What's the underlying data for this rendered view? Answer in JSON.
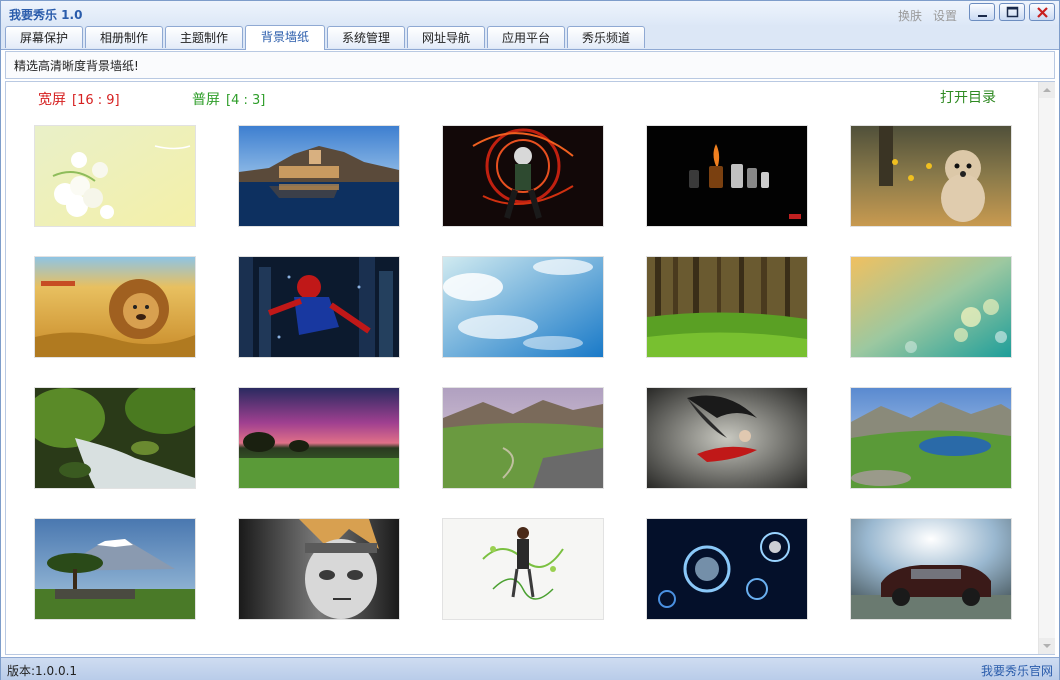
{
  "app": {
    "title": "我要秀乐 1.0",
    "skin_label": "换肤",
    "settings_label": "设置"
  },
  "tabs": [
    {
      "label": "屏幕保护",
      "active": false
    },
    {
      "label": "相册制作",
      "active": false
    },
    {
      "label": "主题制作",
      "active": false
    },
    {
      "label": "背景墙纸",
      "active": true
    },
    {
      "label": "系统管理",
      "active": false
    },
    {
      "label": "网址导航",
      "active": false
    },
    {
      "label": "应用平台",
      "active": false
    },
    {
      "label": "秀乐频道",
      "active": false
    }
  ],
  "info": {
    "text": "精选高清晰度背景墙纸!"
  },
  "filters": {
    "wide_label": "宽屏",
    "wide_ratio": "[16 : 9]",
    "normal_label": "普屏",
    "normal_ratio": "[4 : 3]",
    "open_dir_label": "打开目录"
  },
  "colors": {
    "accent": "#2a5cab",
    "wide_filter": "#d62020",
    "normal_filter": "#2f9e2a"
  },
  "wallpapers": [
    {
      "subject": "white roses on pale green",
      "icon": "roses-thumbnail"
    },
    {
      "subject": "coastal town at dusk reflected in water",
      "icon": "coastal-town-thumbnail"
    },
    {
      "subject": "anime ninja with red energy swirls",
      "icon": "ninja-thumbnail"
    },
    {
      "subject": "perfume bottles with flame on black",
      "icon": "perfume-thumbnail"
    },
    {
      "subject": "fluffy puppy among flowers",
      "icon": "puppy-thumbnail"
    },
    {
      "subject": "lion in golden grass",
      "icon": "lion-thumbnail"
    },
    {
      "subject": "spider hero over city lights",
      "icon": "spider-hero-thumbnail"
    },
    {
      "subject": "blue sky with scattered clouds",
      "icon": "sky-clouds-thumbnail"
    },
    {
      "subject": "sunlit forest with green grass",
      "icon": "forest-thumbnail"
    },
    {
      "subject": "teal bokeh lights",
      "icon": "bokeh-thumbnail"
    },
    {
      "subject": "mossy stream in forest",
      "icon": "stream-thumbnail"
    },
    {
      "subject": "purple sunset over grassland",
      "icon": "sunset-thumbnail"
    },
    {
      "subject": "green valley with mountains",
      "icon": "valley-thumbnail"
    },
    {
      "subject": "dark angel with red dress",
      "icon": "dark-angel-thumbnail"
    },
    {
      "subject": "mountain lake with green hills",
      "icon": "mountain-lake-thumbnail"
    },
    {
      "subject": "elephants under acacia tree with snowy mountain",
      "icon": "savanna-thumbnail"
    },
    {
      "subject": "monochrome anime ninja face",
      "icon": "anime-face-thumbnail"
    },
    {
      "subject": "girl with green floral swirls on white",
      "icon": "floral-girl-thumbnail"
    },
    {
      "subject": "glowing blue circular patterns",
      "icon": "blue-circles-thumbnail"
    },
    {
      "subject": "dark luxury car with sun flare",
      "icon": "car-thumbnail"
    }
  ],
  "status": {
    "version": "版本:1.0.0.1",
    "official_site": "我要秀乐官网"
  }
}
